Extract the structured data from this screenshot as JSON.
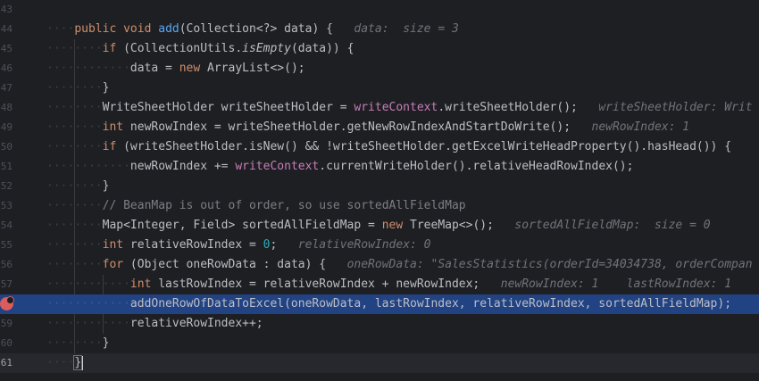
{
  "gutter": {
    "line_numbers": [
      "43",
      "44",
      "45",
      "46",
      "47",
      "48",
      "49",
      "50",
      "51",
      "52",
      "53",
      "54",
      "55",
      "56",
      "57",
      "58",
      "59",
      "60",
      "61"
    ]
  },
  "hints": {
    "data": "data:  size = 3",
    "writeSheetHolder": "writeSheetHolder: Writ",
    "newRowIndex": "newRowIndex: 1",
    "sortedAllFieldMap": "sortedAllFieldMap:  size = 0",
    "relativeRowIndex": "relativeRowIndex: 0",
    "oneRowData": "oneRowData: \"SalesStatistics(orderId=34034738, orderCompan",
    "lastRow_newRowIndex": "newRowIndex: 1",
    "lastRow_lastRowIndex": "lastRowIndex: 1"
  },
  "code": {
    "l44": {
      "kw1": "public",
      "kw2": "void",
      "fn": "add",
      "rest": "(Collection<?> data) {"
    },
    "l45": {
      "kw": "if",
      "a": " (CollectionUtils.",
      "it": "isEmpty",
      "b": "(data)) {"
    },
    "l46": {
      "a": "data = ",
      "kw": "new",
      "b": " ArrayList<>();"
    },
    "l47": {
      "a": "}"
    },
    "l48": {
      "a": "WriteSheetHolder writeSheetHolder = ",
      "field": "writeContext",
      "b": ".writeSheetHolder();"
    },
    "l49": {
      "kw": "int",
      "a": " newRowIndex = writeSheetHolder.getNewRowIndexAndStartDoWrite();"
    },
    "l50": {
      "kw": "if",
      "a": " (writeSheetHolder.isNew() && !writeSheetHolder.getExcelWriteHeadProperty().hasHead()) {"
    },
    "l51": {
      "a": "newRowIndex += ",
      "field": "writeContext",
      "b": ".currentWriteHolder().relativeHeadRowIndex();"
    },
    "l52": {
      "a": "}"
    },
    "l53": {
      "cmt": "// BeanMap is out of order, so use sortedAllFieldMap"
    },
    "l54": {
      "a": "Map<Integer, Field> sortedAllFieldMap = ",
      "kw": "new",
      "b": " TreeMap<>();"
    },
    "l55": {
      "kw": "int",
      "a": " relativeRowIndex = ",
      "num": "0",
      "b": ";"
    },
    "l56": {
      "kw": "for",
      "a": " (Object oneRowData : data) {"
    },
    "l57": {
      "kw": "int",
      "a": " lastRowIndex = relativeRowIndex + newRowIndex;"
    },
    "l58": {
      "a": "addOneRowOfDataToExcel(oneRowData, lastRowIndex, relativeRowIndex, sortedAllFieldMap);"
    },
    "l59": {
      "a": "relativeRowIndex++;"
    },
    "l60": {
      "a": "}"
    },
    "l61": {
      "a": "}"
    }
  },
  "colors": {
    "background": "#1e1f22",
    "selection": "#214283",
    "keyword": "#cf8e6d",
    "method": "#56a8f5",
    "field": "#c77dbb",
    "number": "#2aacb8",
    "breakpoint": "#db5c5c"
  },
  "breakpoint_icon": "breakpoint-icon"
}
